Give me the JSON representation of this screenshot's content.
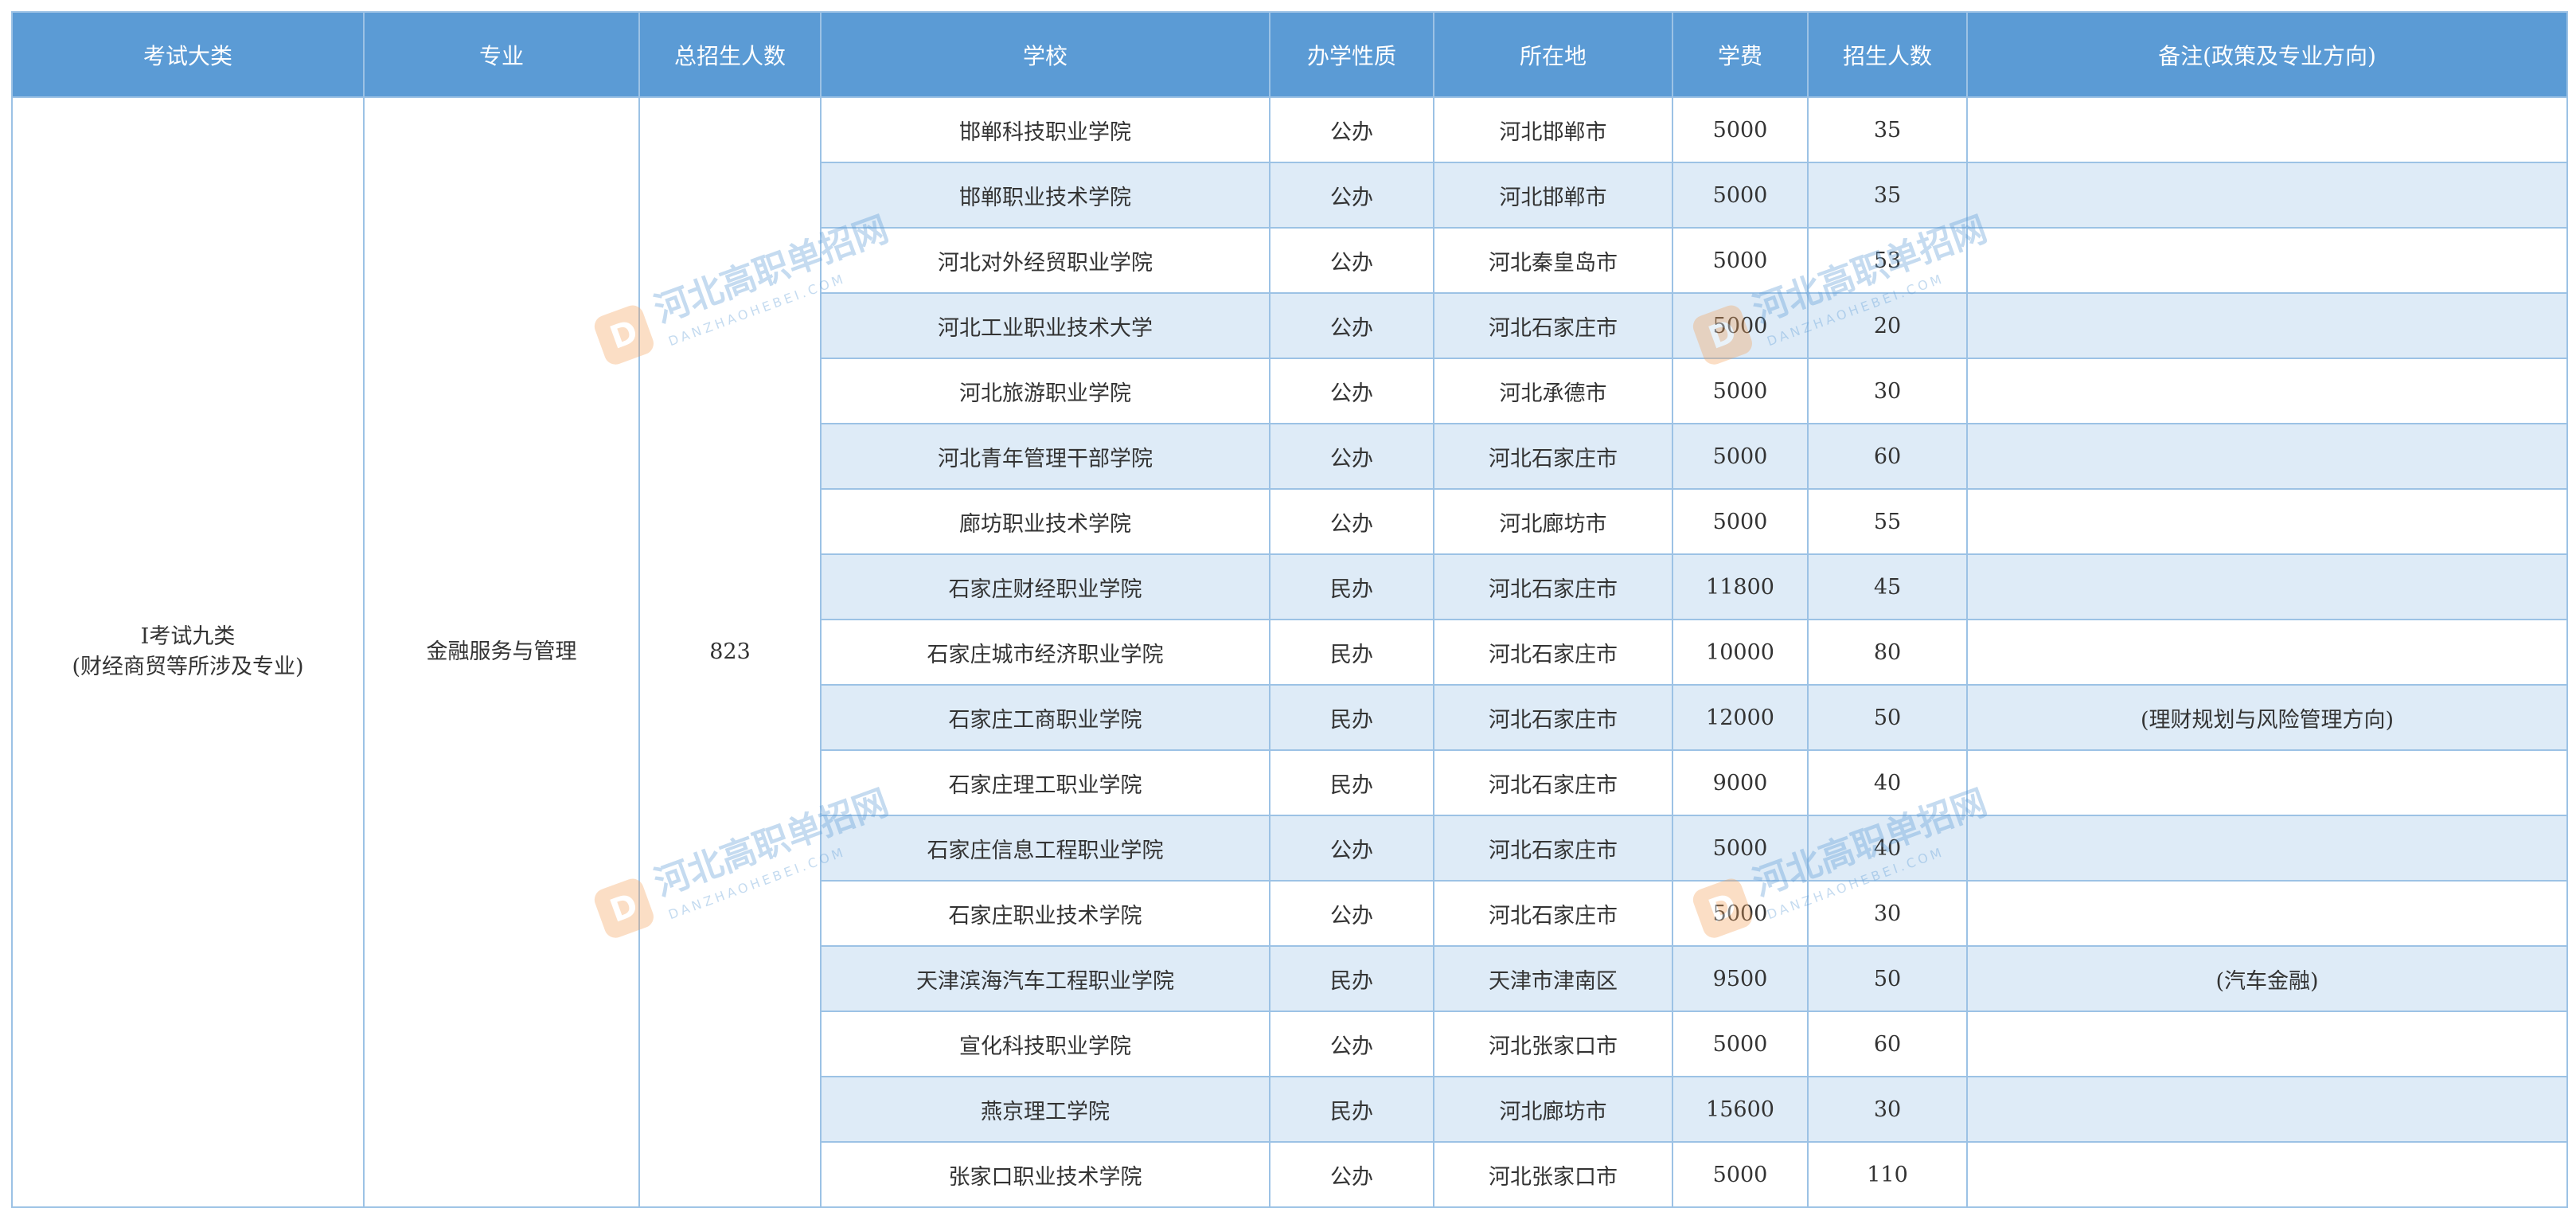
{
  "headers": [
    "考试大类",
    "专业",
    "总招生人数",
    "学校",
    "办学性质",
    "所在地",
    "学费",
    "招生人数",
    "备注(政策及专业方向)"
  ],
  "category_line1": "I考试九类",
  "category_line2": "(财经商贸等所涉及专业)",
  "major": "金融服务与管理",
  "total": "823",
  "rows": [
    {
      "school": "邯郸科技职业学院",
      "type": "公办",
      "location": "河北邯郸市",
      "fee": "5000",
      "count": "35",
      "note": ""
    },
    {
      "school": "邯郸职业技术学院",
      "type": "公办",
      "location": "河北邯郸市",
      "fee": "5000",
      "count": "35",
      "note": ""
    },
    {
      "school": "河北对外经贸职业学院",
      "type": "公办",
      "location": "河北秦皇岛市",
      "fee": "5000",
      "count": "53",
      "note": ""
    },
    {
      "school": "河北工业职业技术大学",
      "type": "公办",
      "location": "河北石家庄市",
      "fee": "5000",
      "count": "20",
      "note": ""
    },
    {
      "school": "河北旅游职业学院",
      "type": "公办",
      "location": "河北承德市",
      "fee": "5000",
      "count": "30",
      "note": ""
    },
    {
      "school": "河北青年管理干部学院",
      "type": "公办",
      "location": "河北石家庄市",
      "fee": "5000",
      "count": "60",
      "note": ""
    },
    {
      "school": "廊坊职业技术学院",
      "type": "公办",
      "location": "河北廊坊市",
      "fee": "5000",
      "count": "55",
      "note": ""
    },
    {
      "school": "石家庄财经职业学院",
      "type": "民办",
      "location": "河北石家庄市",
      "fee": "11800",
      "count": "45",
      "note": ""
    },
    {
      "school": "石家庄城市经济职业学院",
      "type": "民办",
      "location": "河北石家庄市",
      "fee": "10000",
      "count": "80",
      "note": ""
    },
    {
      "school": "石家庄工商职业学院",
      "type": "民办",
      "location": "河北石家庄市",
      "fee": "12000",
      "count": "50",
      "note": "(理财规划与风险管理方向)"
    },
    {
      "school": "石家庄理工职业学院",
      "type": "民办",
      "location": "河北石家庄市",
      "fee": "9000",
      "count": "40",
      "note": ""
    },
    {
      "school": "石家庄信息工程职业学院",
      "type": "公办",
      "location": "河北石家庄市",
      "fee": "5000",
      "count": "40",
      "note": ""
    },
    {
      "school": "石家庄职业技术学院",
      "type": "公办",
      "location": "河北石家庄市",
      "fee": "5000",
      "count": "30",
      "note": ""
    },
    {
      "school": "天津滨海汽车工程职业学院",
      "type": "民办",
      "location": "天津市津南区",
      "fee": "9500",
      "count": "50",
      "note": "(汽车金融)"
    },
    {
      "school": "宣化科技职业学院",
      "type": "公办",
      "location": "河北张家口市",
      "fee": "5000",
      "count": "60",
      "note": ""
    },
    {
      "school": "燕京理工学院",
      "type": "民办",
      "location": "河北廊坊市",
      "fee": "15600",
      "count": "30",
      "note": ""
    },
    {
      "school": "张家口职业技术学院",
      "type": "公办",
      "location": "河北张家口市",
      "fee": "5000",
      "count": "110",
      "note": ""
    }
  ],
  "watermark": {
    "brand": "河北高职单招网",
    "domain": "DANZHAOHEBEI.COM",
    "logo_letter": "D"
  }
}
